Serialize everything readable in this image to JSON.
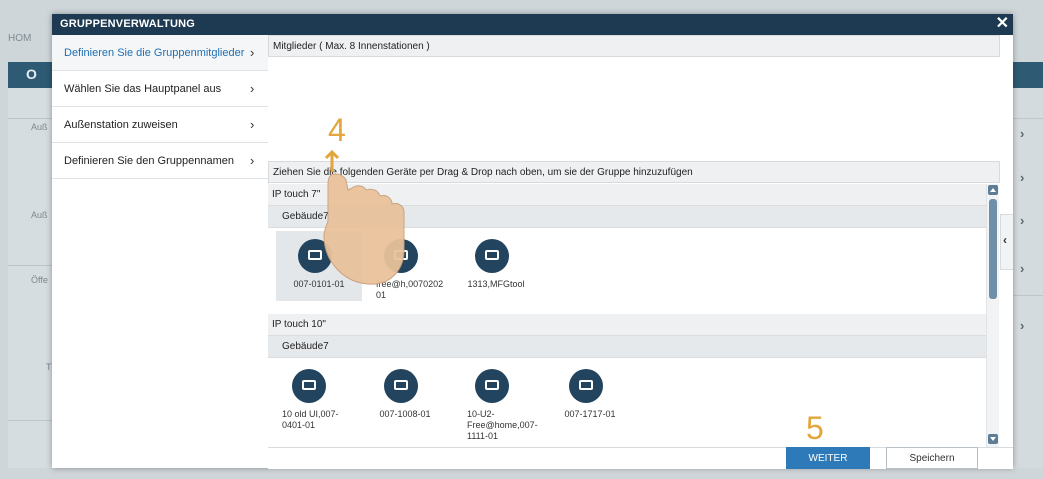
{
  "background": {
    "home_label": "HOM",
    "band_letter": "O",
    "side_labels": [
      "Auß",
      "Auß",
      "Öffe",
      "T"
    ],
    "right_chevron": "›"
  },
  "modal": {
    "title": "GRUPPENVERWALTUNG",
    "close_glyph": "✕"
  },
  "steps": [
    {
      "label": "Definieren Sie die Gruppenmitglieder",
      "active": true
    },
    {
      "label": "Wählen Sie das Hauptpanel aus",
      "active": false
    },
    {
      "label": "Außenstation zuweisen",
      "active": false
    },
    {
      "label": "Definieren Sie den Gruppennamen",
      "active": false
    }
  ],
  "step_chevron": "›",
  "members": {
    "header": "Mitglieder ( Max. 8 Innenstationen )"
  },
  "drag_hint": "Ziehen Sie die folgenden Geräte per Drag & Drop nach oben, um sie der Gruppe hinzuzufügen",
  "groups": [
    {
      "title": "IP touch 7\"",
      "building": "Gebäude7",
      "devices": [
        {
          "label": "007-0101-01",
          "selected": true
        },
        {
          "label": "free@h,0070202 01",
          "selected": false
        },
        {
          "label": "1313,MFGtool",
          "selected": false
        }
      ]
    },
    {
      "title": "IP touch 10\"",
      "building": "Gebäude7",
      "devices": [
        {
          "label": "10 old UI,007-0401-01",
          "selected": false
        },
        {
          "label": "007-1008-01",
          "selected": false
        },
        {
          "label": "10-U2-Free@home,007-1111-01",
          "selected": false
        },
        {
          "label": "007-1717-01",
          "selected": false
        }
      ]
    }
  ],
  "collapse_glyph": "‹",
  "buttons": {
    "next": "WEITER",
    "save": "Speichern"
  },
  "annotations": {
    "step_marker_1": "4",
    "step_marker_2": "5"
  },
  "colors": {
    "header_bg": "#1d3a52",
    "accent": "#2e7ab8",
    "device_icon": "#22445f",
    "marker": "#e3a63c"
  }
}
